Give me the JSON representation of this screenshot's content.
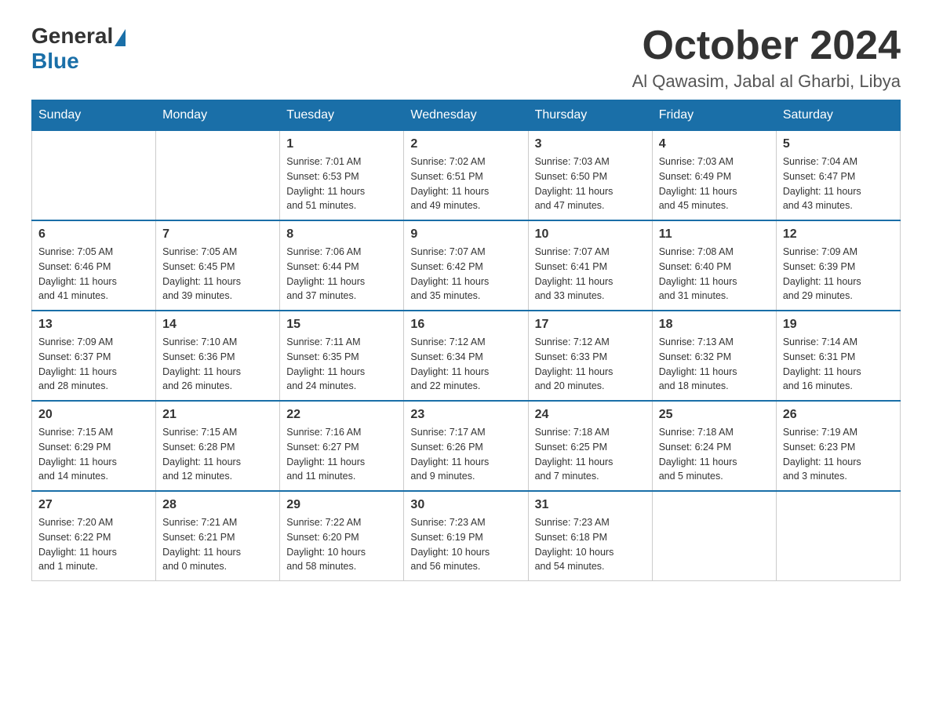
{
  "header": {
    "logo_general": "General",
    "logo_blue": "Blue",
    "month_title": "October 2024",
    "location": "Al Qawasim, Jabal al Gharbi, Libya"
  },
  "days_of_week": [
    "Sunday",
    "Monday",
    "Tuesday",
    "Wednesday",
    "Thursday",
    "Friday",
    "Saturday"
  ],
  "weeks": [
    {
      "days": [
        {
          "number": "",
          "info": ""
        },
        {
          "number": "",
          "info": ""
        },
        {
          "number": "1",
          "info": "Sunrise: 7:01 AM\nSunset: 6:53 PM\nDaylight: 11 hours\nand 51 minutes."
        },
        {
          "number": "2",
          "info": "Sunrise: 7:02 AM\nSunset: 6:51 PM\nDaylight: 11 hours\nand 49 minutes."
        },
        {
          "number": "3",
          "info": "Sunrise: 7:03 AM\nSunset: 6:50 PM\nDaylight: 11 hours\nand 47 minutes."
        },
        {
          "number": "4",
          "info": "Sunrise: 7:03 AM\nSunset: 6:49 PM\nDaylight: 11 hours\nand 45 minutes."
        },
        {
          "number": "5",
          "info": "Sunrise: 7:04 AM\nSunset: 6:47 PM\nDaylight: 11 hours\nand 43 minutes."
        }
      ]
    },
    {
      "days": [
        {
          "number": "6",
          "info": "Sunrise: 7:05 AM\nSunset: 6:46 PM\nDaylight: 11 hours\nand 41 minutes."
        },
        {
          "number": "7",
          "info": "Sunrise: 7:05 AM\nSunset: 6:45 PM\nDaylight: 11 hours\nand 39 minutes."
        },
        {
          "number": "8",
          "info": "Sunrise: 7:06 AM\nSunset: 6:44 PM\nDaylight: 11 hours\nand 37 minutes."
        },
        {
          "number": "9",
          "info": "Sunrise: 7:07 AM\nSunset: 6:42 PM\nDaylight: 11 hours\nand 35 minutes."
        },
        {
          "number": "10",
          "info": "Sunrise: 7:07 AM\nSunset: 6:41 PM\nDaylight: 11 hours\nand 33 minutes."
        },
        {
          "number": "11",
          "info": "Sunrise: 7:08 AM\nSunset: 6:40 PM\nDaylight: 11 hours\nand 31 minutes."
        },
        {
          "number": "12",
          "info": "Sunrise: 7:09 AM\nSunset: 6:39 PM\nDaylight: 11 hours\nand 29 minutes."
        }
      ]
    },
    {
      "days": [
        {
          "number": "13",
          "info": "Sunrise: 7:09 AM\nSunset: 6:37 PM\nDaylight: 11 hours\nand 28 minutes."
        },
        {
          "number": "14",
          "info": "Sunrise: 7:10 AM\nSunset: 6:36 PM\nDaylight: 11 hours\nand 26 minutes."
        },
        {
          "number": "15",
          "info": "Sunrise: 7:11 AM\nSunset: 6:35 PM\nDaylight: 11 hours\nand 24 minutes."
        },
        {
          "number": "16",
          "info": "Sunrise: 7:12 AM\nSunset: 6:34 PM\nDaylight: 11 hours\nand 22 minutes."
        },
        {
          "number": "17",
          "info": "Sunrise: 7:12 AM\nSunset: 6:33 PM\nDaylight: 11 hours\nand 20 minutes."
        },
        {
          "number": "18",
          "info": "Sunrise: 7:13 AM\nSunset: 6:32 PM\nDaylight: 11 hours\nand 18 minutes."
        },
        {
          "number": "19",
          "info": "Sunrise: 7:14 AM\nSunset: 6:31 PM\nDaylight: 11 hours\nand 16 minutes."
        }
      ]
    },
    {
      "days": [
        {
          "number": "20",
          "info": "Sunrise: 7:15 AM\nSunset: 6:29 PM\nDaylight: 11 hours\nand 14 minutes."
        },
        {
          "number": "21",
          "info": "Sunrise: 7:15 AM\nSunset: 6:28 PM\nDaylight: 11 hours\nand 12 minutes."
        },
        {
          "number": "22",
          "info": "Sunrise: 7:16 AM\nSunset: 6:27 PM\nDaylight: 11 hours\nand 11 minutes."
        },
        {
          "number": "23",
          "info": "Sunrise: 7:17 AM\nSunset: 6:26 PM\nDaylight: 11 hours\nand 9 minutes."
        },
        {
          "number": "24",
          "info": "Sunrise: 7:18 AM\nSunset: 6:25 PM\nDaylight: 11 hours\nand 7 minutes."
        },
        {
          "number": "25",
          "info": "Sunrise: 7:18 AM\nSunset: 6:24 PM\nDaylight: 11 hours\nand 5 minutes."
        },
        {
          "number": "26",
          "info": "Sunrise: 7:19 AM\nSunset: 6:23 PM\nDaylight: 11 hours\nand 3 minutes."
        }
      ]
    },
    {
      "days": [
        {
          "number": "27",
          "info": "Sunrise: 7:20 AM\nSunset: 6:22 PM\nDaylight: 11 hours\nand 1 minute."
        },
        {
          "number": "28",
          "info": "Sunrise: 7:21 AM\nSunset: 6:21 PM\nDaylight: 11 hours\nand 0 minutes."
        },
        {
          "number": "29",
          "info": "Sunrise: 7:22 AM\nSunset: 6:20 PM\nDaylight: 10 hours\nand 58 minutes."
        },
        {
          "number": "30",
          "info": "Sunrise: 7:23 AM\nSunset: 6:19 PM\nDaylight: 10 hours\nand 56 minutes."
        },
        {
          "number": "31",
          "info": "Sunrise: 7:23 AM\nSunset: 6:18 PM\nDaylight: 10 hours\nand 54 minutes."
        },
        {
          "number": "",
          "info": ""
        },
        {
          "number": "",
          "info": ""
        }
      ]
    }
  ]
}
